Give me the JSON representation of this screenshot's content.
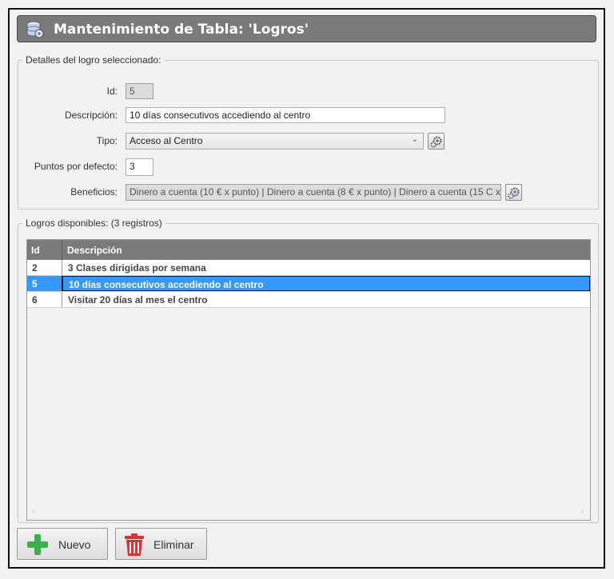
{
  "window": {
    "title": "Mantenimiento de Tabla: 'Logros'"
  },
  "details": {
    "legend": "Detalles del logro seleccionado:",
    "id_label": "Id:",
    "id_value": "5",
    "descripcion_label": "Descripción:",
    "descripcion_value": "10 días consecutivos accediendo al centro",
    "tipo_label": "Tipo:",
    "tipo_value": "Acceso al Centro",
    "puntos_label": "Puntos por defecto:",
    "puntos_value": "3",
    "beneficios_label": "Beneficios:",
    "beneficios_value": "Dinero a cuenta (10 € x punto) | Dinero a cuenta (8 € x punto) | Dinero a cuenta (15 C x..."
  },
  "list": {
    "legend": "Logros disponibles:  (3 registros)",
    "columns": {
      "id": "Id",
      "descripcion": "Descripción"
    },
    "rows": [
      {
        "id": "2",
        "descripcion": "3 Clases dirigidas por semana",
        "selected": false
      },
      {
        "id": "5",
        "descripcion": "10 días consecutivos accediendo al centro",
        "selected": true
      },
      {
        "id": "6",
        "descripcion": "Visitar 20 días al mes el centro",
        "selected": false
      }
    ],
    "scroll_left": "‹",
    "scroll_right": "›"
  },
  "buttons": {
    "new_label": "Nuevo",
    "delete_label": "Eliminar"
  },
  "colors": {
    "titlebar": "#7a7a7a",
    "selection": "#3399ff",
    "add_icon": "#3cb04a",
    "delete_icon": "#e03030"
  },
  "icons": {
    "app": "database-gear-icon",
    "tipo_config": "gear-icon",
    "beneficios_config": "gear-icon",
    "new": "plus-icon",
    "delete": "trash-icon"
  }
}
